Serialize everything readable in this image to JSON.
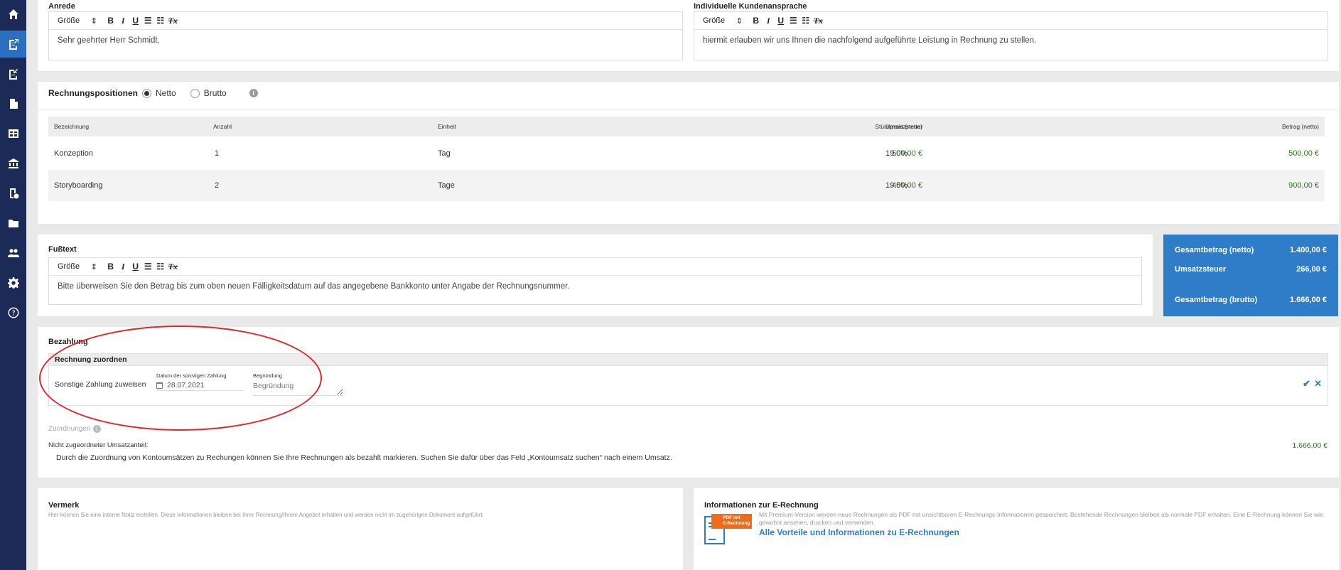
{
  "sidebar": {
    "items": [
      {
        "icon": "home-icon"
      },
      {
        "icon": "invoice-out-icon"
      },
      {
        "icon": "invoice-in-icon"
      },
      {
        "icon": "document-icon"
      },
      {
        "icon": "table-icon"
      },
      {
        "icon": "bank-icon"
      },
      {
        "icon": "receipt-icon"
      },
      {
        "icon": "folder-icon"
      },
      {
        "icon": "users-icon"
      },
      {
        "icon": "gear-icon"
      },
      {
        "icon": "help-icon"
      }
    ]
  },
  "anrede": {
    "label": "Anrede",
    "size_label": "Größe",
    "text": "Sehr geehrter Herr Schmidt,"
  },
  "kundenansprache": {
    "label": "Individuelle Kundenansprache",
    "size_label": "Größe",
    "text": "hiermit erlauben wir uns Ihnen die nachfolgend aufgeführte Leistung in Rechnung zu stellen."
  },
  "positions": {
    "title": "Rechnungspositionen",
    "netto_label": "Netto",
    "brutto_label": "Brutto",
    "columns": {
      "bezeichnung": "Bezeichnung",
      "anzahl": "Anzahl",
      "einheit": "Einheit",
      "stueckpreis": "Stückpreis (netto)",
      "umsatzsteuer": "Umsatzsteuer",
      "betrag": "Betrag (netto)"
    },
    "rows": [
      {
        "bezeichnung": "Konzeption",
        "anzahl": "1",
        "einheit": "Tag",
        "stueckpreis": "500,00 €",
        "umsatzsteuer": "19.0%",
        "betrag": "500,00 €"
      },
      {
        "bezeichnung": "Storyboarding",
        "anzahl": "2",
        "einheit": "Tage",
        "stueckpreis": "450,00 €",
        "umsatzsteuer": "19.0%",
        "betrag": "900,00 €"
      }
    ]
  },
  "fusstext": {
    "label": "Fußtext",
    "size_label": "Größe",
    "text": "Bitte überweisen Sie den Betrag bis zum oben neuen Fälligkeitsdatum auf das angegebene Bankkonto unter Angabe der Rechnungsnummer."
  },
  "totals": {
    "netto_label": "Gesamtbetrag (netto)",
    "netto_value": "1.400,00 €",
    "ust_label": "Umsatzsteuer",
    "ust_value": "266,00 €",
    "brutto_label": "Gesamtbetrag (brutto)",
    "brutto_value": "1.666,00 €"
  },
  "bezahlung": {
    "title": "Bezahlung",
    "zuordnen_title": "Rechnung zuordnen",
    "sonstige_label": "Sonstige Zahlung zuweisen",
    "datum_label": "Datum der sonstigen Zahlung",
    "datum_value": "28.07.2021",
    "begruendung_label": "Begründung",
    "begruendung_placeholder": "Begründung",
    "zuordnungen_label": "Zuordnungen",
    "nicht_zugeordnet_label": "Nicht zugeordneter Umsatzanteil:",
    "nicht_zugeordnet_value": "1.666,00 €",
    "hint": "Durch die Zuordnung von Kontoumsätzen zu Rechungen können Sie Ihre Rechnungen als bezahlt markieren. Suchen Sie dafür über das Feld „Kontoumsatz suchen“ nach einem Umsatz."
  },
  "vermerk": {
    "title": "Vermerk",
    "hint": "Hier können Sie eine interne Notiz erstellen. Diese Informationen bleiben bei Ihrer Rechnung/Ihrem Angebot erhalten und werden nicht im zugehörigen Dokument aufgeführt."
  },
  "erechnung": {
    "title": "Informationen zur E-Rechnung",
    "text": "Mit Premium-Version werden neue Rechnungen als PDF mit unsichtbaren E-Rechnungs-Informationen gespeichert. Bestehende Rechnungen bleiben als normale PDF erhalten. Eine E-Rechnung können Sie wie gewohnt ansehen, drucken und versenden.",
    "badge_line1": "PDF mit",
    "badge_line2": "E-Rechnung",
    "link": "Alle Vorteile und Informationen zu E-Rechnungen"
  },
  "colors": {
    "sidebar": "#1c2a57",
    "accent": "#2f7dc8",
    "green": "#2a7a18",
    "annotation": "#e32629"
  }
}
